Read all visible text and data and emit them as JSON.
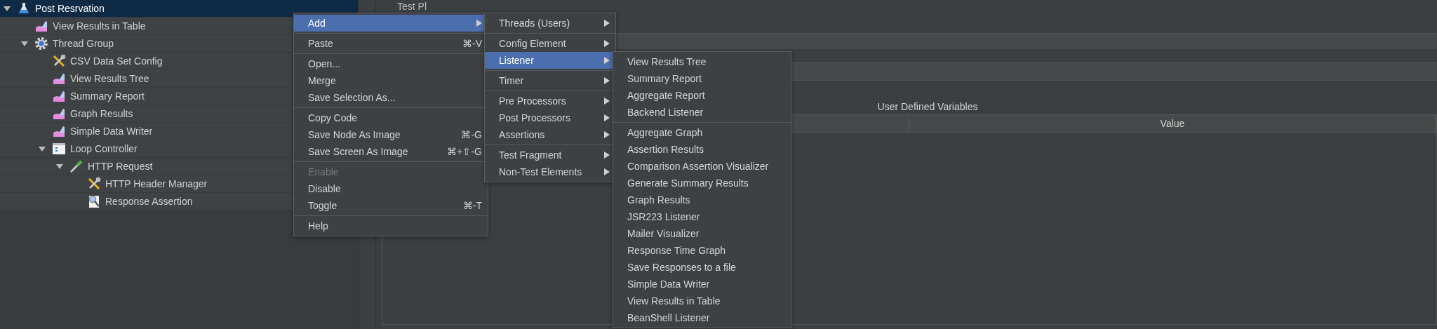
{
  "tree": [
    {
      "label": "Post Resrvation",
      "kind": "test-plan",
      "selected": true,
      "expanded": true,
      "children": [
        {
          "label": "View Results in Table",
          "kind": "listener",
          "selected": false
        },
        {
          "label": "Thread Group",
          "kind": "thread-group",
          "selected": false,
          "expanded": true,
          "children": [
            {
              "label": "CSV Data Set Config",
              "kind": "config",
              "selected": false
            },
            {
              "label": "View Results Tree",
              "kind": "listener",
              "selected": false
            },
            {
              "label": "Summary Report",
              "kind": "listener",
              "selected": false
            },
            {
              "label": "Graph Results",
              "kind": "listener",
              "selected": false
            },
            {
              "label": "Simple Data Writer",
              "kind": "listener",
              "selected": false
            },
            {
              "label": "Loop Controller",
              "kind": "controller",
              "selected": false,
              "expanded": true,
              "children": [
                {
                  "label": "HTTP Request",
                  "kind": "sampler",
                  "selected": false,
                  "expanded": true,
                  "children": [
                    {
                      "label": "HTTP Header Manager",
                      "kind": "config",
                      "selected": false
                    },
                    {
                      "label": "Response Assertion",
                      "kind": "assertion",
                      "selected": false
                    }
                  ]
                }
              ]
            }
          ]
        }
      ]
    }
  ],
  "panel": {
    "title": "Test Pl",
    "table": {
      "title": "User Defined Variables",
      "columns": [
        "Value"
      ]
    }
  },
  "context_menu": [
    [
      {
        "label": "Add",
        "submenu": true,
        "selected": true,
        "disabled": false
      }
    ],
    [
      {
        "label": "Paste",
        "shortcut": "⌘-V",
        "selected": false,
        "disabled": false
      }
    ],
    [
      {
        "label": "Open...",
        "selected": false,
        "disabled": false
      },
      {
        "label": "Merge",
        "selected": false,
        "disabled": false
      },
      {
        "label": "Save Selection As...",
        "selected": false,
        "disabled": false
      }
    ],
    [
      {
        "label": "Copy Code",
        "selected": false,
        "disabled": false
      },
      {
        "label": "Save Node As Image",
        "shortcut": "⌘-G",
        "selected": false,
        "disabled": false
      },
      {
        "label": "Save Screen As Image",
        "shortcut": "⌘+⇧-G",
        "selected": false,
        "disabled": false
      }
    ],
    [
      {
        "label": "Enable",
        "selected": false,
        "disabled": true
      },
      {
        "label": "Disable",
        "selected": false,
        "disabled": false
      },
      {
        "label": "Toggle",
        "shortcut": "⌘-T",
        "selected": false,
        "disabled": false
      }
    ],
    [
      {
        "label": "Help",
        "selected": false,
        "disabled": false
      }
    ]
  ],
  "add_menu": [
    [
      {
        "label": "Threads (Users)",
        "submenu": true,
        "selected": false,
        "disabled": false
      }
    ],
    [
      {
        "label": "Config Element",
        "submenu": true,
        "selected": false,
        "disabled": false
      },
      {
        "label": "Listener",
        "submenu": true,
        "selected": true,
        "disabled": false
      }
    ],
    [
      {
        "label": "Timer",
        "submenu": true,
        "selected": false,
        "disabled": false
      }
    ],
    [
      {
        "label": "Pre Processors",
        "submenu": true,
        "selected": false,
        "disabled": false
      },
      {
        "label": "Post Processors",
        "submenu": true,
        "selected": false,
        "disabled": false
      },
      {
        "label": "Assertions",
        "submenu": true,
        "selected": false,
        "disabled": false
      }
    ],
    [
      {
        "label": "Test Fragment",
        "submenu": true,
        "selected": false,
        "disabled": false
      },
      {
        "label": "Non-Test Elements",
        "submenu": true,
        "selected": false,
        "disabled": false
      }
    ]
  ],
  "listener_menu": [
    [
      {
        "label": "View Results Tree",
        "selected": false,
        "disabled": false
      },
      {
        "label": "Summary Report",
        "selected": false,
        "disabled": false
      },
      {
        "label": "Aggregate Report",
        "selected": false,
        "disabled": false
      },
      {
        "label": "Backend Listener",
        "selected": false,
        "disabled": false
      }
    ],
    [
      {
        "label": "Aggregate Graph",
        "selected": false,
        "disabled": false
      },
      {
        "label": "Assertion Results",
        "selected": false,
        "disabled": false
      },
      {
        "label": "Comparison Assertion Visualizer",
        "selected": false,
        "disabled": false
      },
      {
        "label": "Generate Summary Results",
        "selected": false,
        "disabled": false
      },
      {
        "label": "Graph Results",
        "selected": false,
        "disabled": false
      },
      {
        "label": "JSR223 Listener",
        "selected": false,
        "disabled": false
      },
      {
        "label": "Mailer Visualizer",
        "selected": false,
        "disabled": false
      },
      {
        "label": "Response Time Graph",
        "selected": false,
        "disabled": false
      },
      {
        "label": "Save Responses to a file",
        "selected": false,
        "disabled": false
      },
      {
        "label": "Simple Data Writer",
        "selected": false,
        "disabled": false
      },
      {
        "label": "View Results in Table",
        "selected": false,
        "disabled": false
      },
      {
        "label": "BeanShell Listener",
        "selected": false,
        "disabled": false
      }
    ]
  ]
}
